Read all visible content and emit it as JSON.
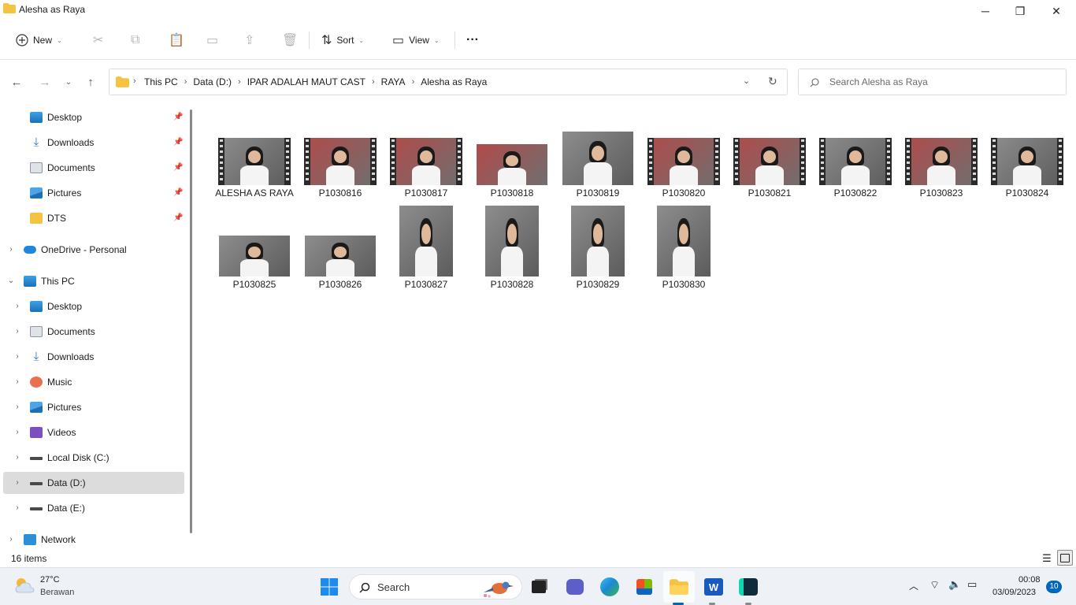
{
  "window": {
    "title": "Alesha as Raya",
    "minimize": "─",
    "maximize": "❐",
    "close": "✕"
  },
  "toolbar": {
    "new_label": "New",
    "sort_label": "Sort",
    "view_label": "View",
    "more_label": "···"
  },
  "address": {
    "crumbs": [
      "This PC",
      "Data (D:)",
      "IPAR ADALAH MAUT CAST",
      "RAYA",
      "Alesha as Raya"
    ]
  },
  "search": {
    "placeholder": "Search Alesha as Raya"
  },
  "sidebar": {
    "quick": [
      {
        "label": "Desktop",
        "icon": "desktop-icon"
      },
      {
        "label": "Downloads",
        "icon": "download-icon"
      },
      {
        "label": "Documents",
        "icon": "document-icon"
      },
      {
        "label": "Pictures",
        "icon": "pictures-icon"
      },
      {
        "label": "DTS",
        "icon": "folder-icon"
      }
    ],
    "onedrive": "OneDrive - Personal",
    "thispc": "This PC",
    "pc_items": [
      {
        "label": "Desktop",
        "icon": "desktop-icon"
      },
      {
        "label": "Documents",
        "icon": "document-icon"
      },
      {
        "label": "Downloads",
        "icon": "download-icon"
      },
      {
        "label": "Music",
        "icon": "music-icon"
      },
      {
        "label": "Pictures",
        "icon": "pictures-icon"
      },
      {
        "label": "Videos",
        "icon": "videos-icon"
      },
      {
        "label": "Local Disk (C:)",
        "icon": "drive-icon"
      },
      {
        "label": "Data (D:)",
        "icon": "drive-icon"
      },
      {
        "label": "Data (E:)",
        "icon": "drive-icon"
      }
    ],
    "network": "Network"
  },
  "files": [
    {
      "name": "ALESHA AS RAYA",
      "type": "video"
    },
    {
      "name": "P1030816",
      "type": "video"
    },
    {
      "name": "P1030817",
      "type": "video"
    },
    {
      "name": "P1030818",
      "type": "photo-landscape"
    },
    {
      "name": "P1030819",
      "type": "photo-landscape"
    },
    {
      "name": "P1030820",
      "type": "video"
    },
    {
      "name": "P1030821",
      "type": "video"
    },
    {
      "name": "P1030822",
      "type": "video"
    },
    {
      "name": "P1030823",
      "type": "video"
    },
    {
      "name": "P1030824",
      "type": "video"
    },
    {
      "name": "P1030825",
      "type": "photo-landscape"
    },
    {
      "name": "P1030826",
      "type": "photo-landscape"
    },
    {
      "name": "P1030827",
      "type": "photo-portrait"
    },
    {
      "name": "P1030828",
      "type": "photo-portrait"
    },
    {
      "name": "P1030829",
      "type": "photo-portrait"
    },
    {
      "name": "P1030830",
      "type": "photo-portrait"
    }
  ],
  "status": {
    "count": "16 items"
  },
  "taskbar": {
    "weather_temp": "27°C",
    "weather_desc": "Berawan",
    "search_label": "Search",
    "time": "00:08",
    "date": "03/09/2023",
    "notifications": "10"
  },
  "colors": {
    "accent": "#0067c0",
    "selected_bg": "#dcdcdc",
    "folder": "#f5c342"
  }
}
